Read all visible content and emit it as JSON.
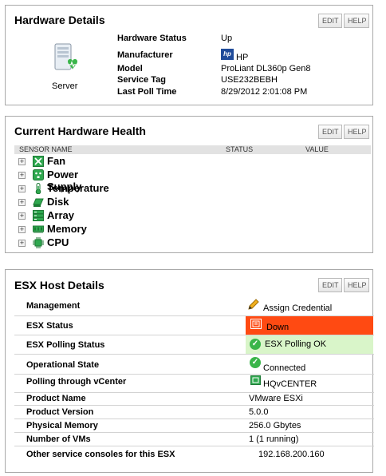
{
  "buttons": {
    "edit": "EDIT",
    "help": "HELP"
  },
  "hardware": {
    "title": "Hardware Details",
    "server_label": "Server",
    "hp_logo_text": "hp",
    "rows": [
      {
        "label": "Hardware Status",
        "value": "Up"
      },
      {
        "label": "Manufacturer",
        "value": "HP"
      },
      {
        "label": "Model",
        "value": "ProLiant DL360p Gen8"
      },
      {
        "label": "Service Tag",
        "value": "USE232BEBH"
      },
      {
        "label": "Last Poll Time",
        "value": "8/29/2012 2:01:08 PM"
      }
    ]
  },
  "health": {
    "title": "Current Hardware Health",
    "columns": {
      "sensor": "SENSOR NAME",
      "status": "STATUS",
      "value": "VALUE"
    },
    "sensors": [
      {
        "label": "Fan",
        "icon": "fan-icon"
      },
      {
        "label": "Power Supply",
        "icon": "power-supply-icon"
      },
      {
        "label": "Temperature",
        "icon": "thermometer-icon"
      },
      {
        "label": "Disk",
        "icon": "disk-icon"
      },
      {
        "label": "Array",
        "icon": "array-icon"
      },
      {
        "label": "Memory",
        "icon": "memory-icon"
      },
      {
        "label": "CPU",
        "icon": "cpu-icon"
      }
    ]
  },
  "esx": {
    "title": "ESX Host Details",
    "rows": [
      {
        "label": "Management",
        "value": "Assign Credential"
      },
      {
        "label": "ESX Status",
        "value": "Down"
      },
      {
        "label": "ESX Polling Status",
        "value": "ESX Polling OK"
      },
      {
        "label": "Operational State",
        "value": "Connected"
      },
      {
        "label": "Polling through vCenter",
        "value": "HQvCENTER"
      },
      {
        "label": "Product Name",
        "value": "VMware ESXi"
      },
      {
        "label": "Product Version",
        "value": "5.0.0"
      },
      {
        "label": "Physical Memory",
        "value": "256.0 Gbytes"
      },
      {
        "label": "Number of VMs",
        "value": "1 (1 running)"
      },
      {
        "label": "Other service consoles for this ESX",
        "value": "192.168.200.160"
      }
    ]
  },
  "colors": {
    "status_down": "#ff4a12",
    "status_ok": "#d9f5c9",
    "icon_green": "#2fa84f"
  }
}
